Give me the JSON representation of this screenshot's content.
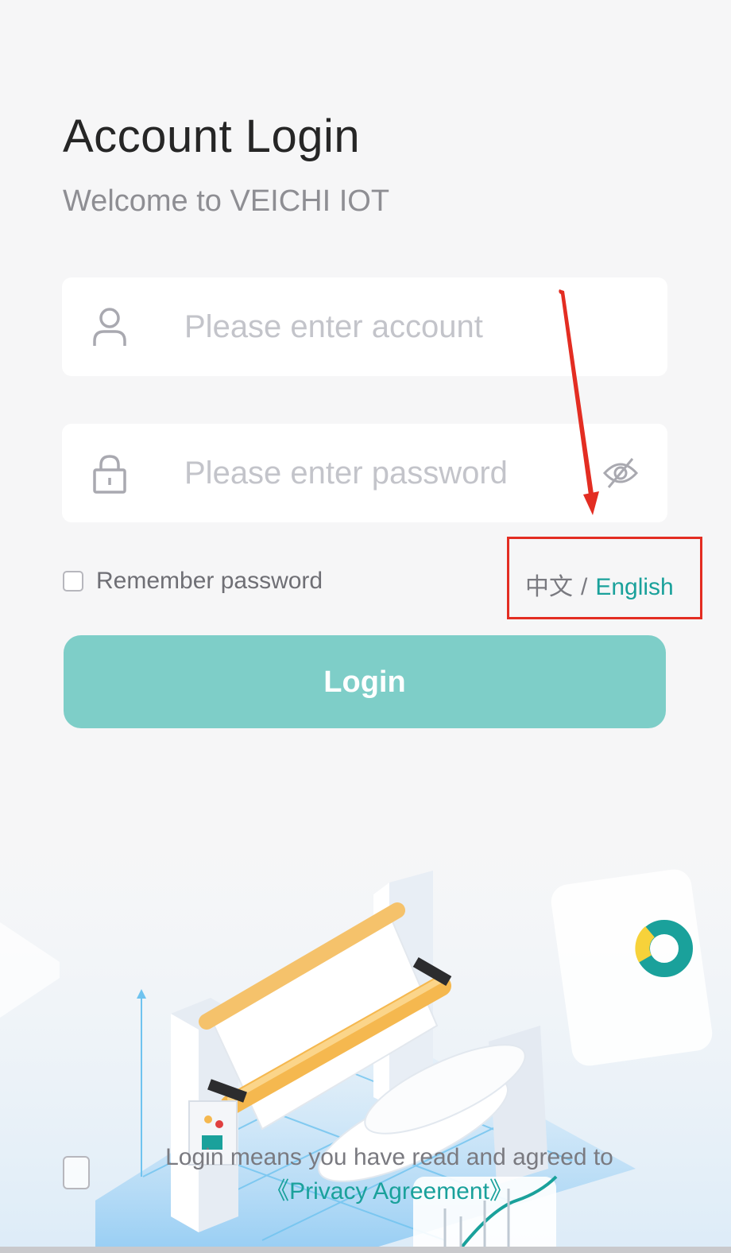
{
  "login": {
    "title": "Account Login",
    "subtitle": "Welcome to VEICHI IOT",
    "account_placeholder": "Please enter account",
    "password_placeholder": "Please enter password",
    "remember_label": "Remember password",
    "lang_zh": "中文",
    "lang_sep": "/",
    "lang_en": "English",
    "login_button": "Login"
  },
  "agreement": {
    "text": "Login means you have read and agreed to ",
    "link": "《Privacy Agreement》"
  },
  "icons": {
    "account": "user-icon",
    "password": "lock-icon",
    "toggle_visibility": "eye-off-icon"
  },
  "colors": {
    "accent": "#1aa19b",
    "button": "#7ecec8",
    "annotation": "#e32d22"
  }
}
